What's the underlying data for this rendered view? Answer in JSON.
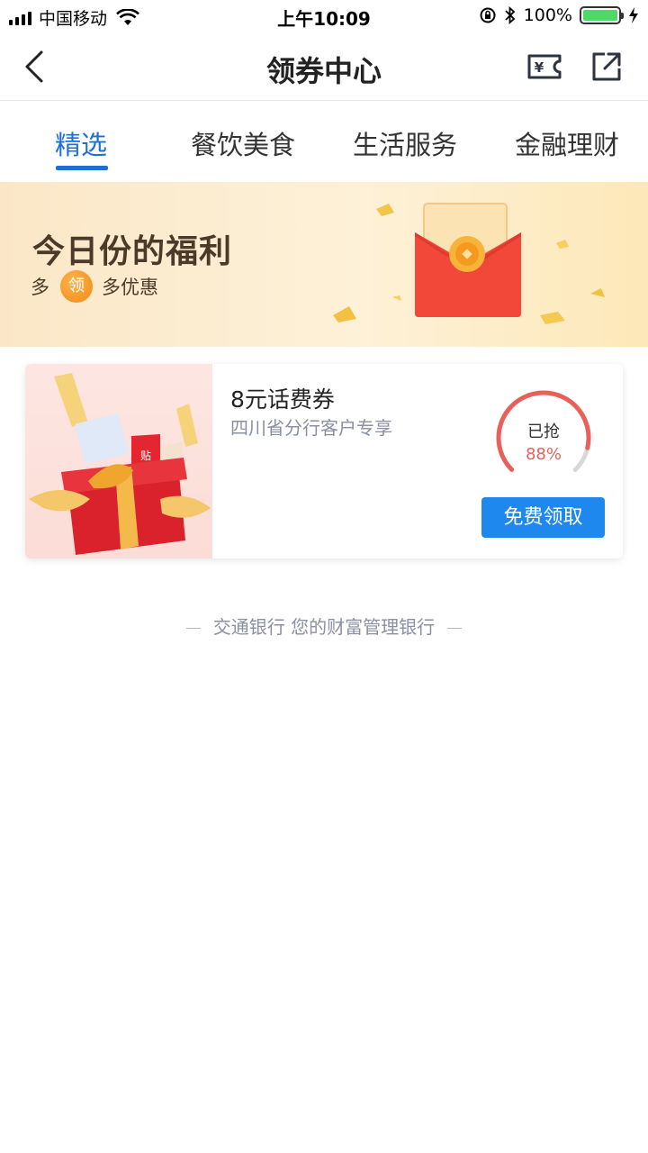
{
  "status_bar": {
    "carrier": "中国移动",
    "time": "上午10:09",
    "battery_text": "100%",
    "battery_level": 1.0
  },
  "nav": {
    "title": "领券中心",
    "back_icon": "chevron-left-icon",
    "coupon_icon": "yuan-ticket-icon",
    "share_icon": "external-share-icon"
  },
  "tabs": [
    {
      "label": "精选",
      "active": true
    },
    {
      "label": "餐饮美食",
      "active": false
    },
    {
      "label": "生活服务",
      "active": false
    },
    {
      "label": "金融理财",
      "active": false
    }
  ],
  "banner": {
    "title": "今日份的福利",
    "sub_prefix": "多",
    "badge": "领",
    "sub_suffix": "多优惠"
  },
  "coupon": {
    "title": "8元话费券",
    "subtitle": "四川省分行客户专享",
    "progress_label": "已抢",
    "progress_value": "88%",
    "progress_fraction": 0.88,
    "button_label": "免费领取",
    "accent": "#1e88ef",
    "progress_color": "#e9605a"
  },
  "footer": {
    "text": "交通银行 您的财富管理银行"
  }
}
